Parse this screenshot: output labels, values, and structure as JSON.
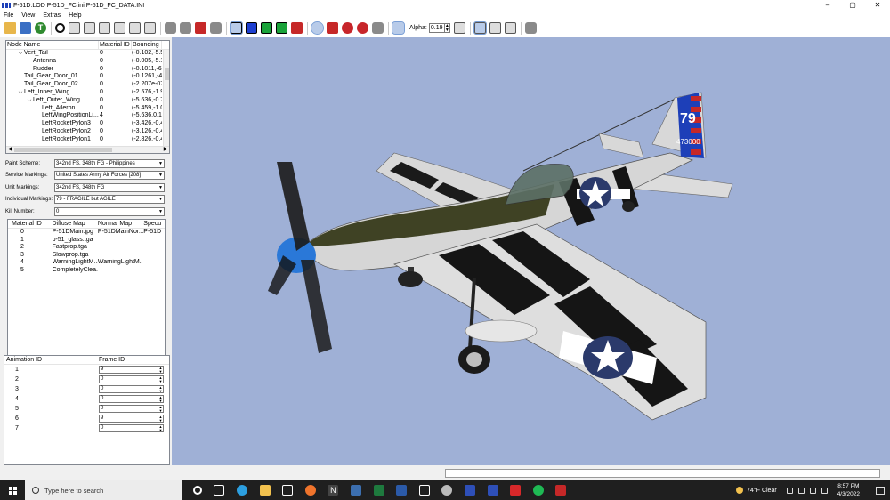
{
  "window": {
    "title": "F-51D.LOD  P-51D_FC.ini  P-51D_FC_DATA.INI",
    "controls": [
      "–",
      "▢",
      "✕"
    ]
  },
  "menu": [
    "File",
    "View",
    "Extras",
    "Help"
  ],
  "toolbar": {
    "alpha_label": "Alpha:",
    "alpha_value": "0.19"
  },
  "tree": {
    "columns": [
      "Node Name",
      "Material ID",
      "Bounding B"
    ],
    "rows": [
      {
        "name": "Vert_Tail",
        "level": 1,
        "expand": "v",
        "mat": "0",
        "bb": "(-0.102,-5.56"
      },
      {
        "name": "Antenna",
        "level": 2,
        "expand": "",
        "mat": "0",
        "bb": "(-0.005,-5.19"
      },
      {
        "name": "Rudder",
        "level": 2,
        "expand": "",
        "mat": "0",
        "bb": "(-0.1011,-6.2"
      },
      {
        "name": "Tail_Gear_Door_01",
        "level": 1,
        "expand": "",
        "mat": "0",
        "bb": "(-0.1261,-4.2"
      },
      {
        "name": "Tail_Gear_Door_02",
        "level": 1,
        "expand": "",
        "mat": "0",
        "bb": "(-2.207e-07,"
      },
      {
        "name": "Left_Inner_Wing",
        "level": 1,
        "expand": "v",
        "mat": "0",
        "bb": "(-2.576,-1.93"
      },
      {
        "name": "Left_Outer_Wing",
        "level": 2,
        "expand": "v",
        "mat": "0",
        "bb": "(-5.636,-0.77"
      },
      {
        "name": "Left_Aileron",
        "level": 3,
        "expand": "",
        "mat": "0",
        "bb": "(-5.459,-1.06"
      },
      {
        "name": "LeftWingPositionLi...",
        "level": 3,
        "expand": "",
        "mat": "4",
        "bb": "(-5.636,0.138"
      },
      {
        "name": "LeftRocketPylon3",
        "level": 3,
        "expand": "",
        "mat": "0",
        "bb": "(-3.426,-0.49"
      },
      {
        "name": "LeftRocketPylon2",
        "level": 3,
        "expand": "",
        "mat": "0",
        "bb": "(-3.126,-0.47"
      },
      {
        "name": "LeftRocketPylon1",
        "level": 3,
        "expand": "",
        "mat": "0",
        "bb": "(-2.826,-0.46"
      }
    ]
  },
  "properties": [
    {
      "label": "Paint Scheme:",
      "value": "342nd FS, 348th FG - Philippines"
    },
    {
      "label": "Service Markings:",
      "value": "United States Army Air Forces [208]"
    },
    {
      "label": "Unit Markings:",
      "value": "342nd FS, 348th FG"
    },
    {
      "label": "Individual Markings:",
      "value": "79 - FRAGILE but AGILE"
    },
    {
      "label": "Kill Number:",
      "value": "0"
    }
  ],
  "materials": {
    "columns": [
      "Material ID",
      "Diffuse Map",
      "Normal Map",
      "Specu"
    ],
    "rows": [
      {
        "id": "0",
        "diffuse": "P-51DMain.jpg",
        "normal": "P-51DMainNor...",
        "spec": "P-51D"
      },
      {
        "id": "1",
        "diffuse": "p-51_glass.tga",
        "normal": "",
        "spec": ""
      },
      {
        "id": "2",
        "diffuse": "Fastprop.tga",
        "normal": "",
        "spec": ""
      },
      {
        "id": "3",
        "diffuse": "Slowprop.tga",
        "normal": "",
        "spec": ""
      },
      {
        "id": "4",
        "diffuse": "WarningLightM...",
        "normal": "WarningLightM...",
        "spec": ""
      },
      {
        "id": "5",
        "diffuse": "CompletelyClea...",
        "normal": "",
        "spec": ""
      }
    ]
  },
  "animations": {
    "columns": [
      "Animation ID",
      "Frame ID"
    ],
    "rows": [
      {
        "id": "1",
        "frame": "9"
      },
      {
        "id": "2",
        "frame": "0"
      },
      {
        "id": "3",
        "frame": "0"
      },
      {
        "id": "4",
        "frame": "0"
      },
      {
        "id": "5",
        "frame": "0"
      },
      {
        "id": "6",
        "frame": "9"
      },
      {
        "id": "7",
        "frame": "0"
      }
    ]
  },
  "viewport": {
    "tail_number": "79",
    "tail_serial": "473000",
    "background": "#9fb0d6"
  },
  "taskbar": {
    "search_placeholder": "Type here to search",
    "weather": "74°F  Clear",
    "time": "8:57 PM",
    "date": "4/3/2022"
  }
}
